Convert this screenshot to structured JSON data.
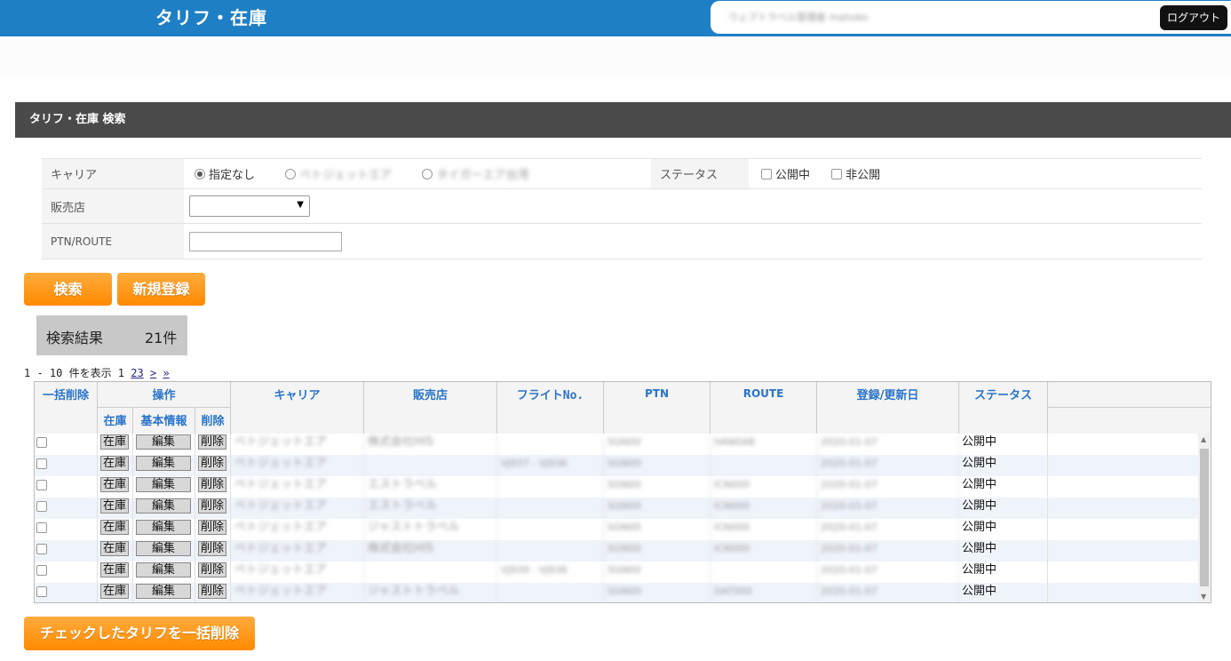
{
  "header": {
    "title": "タリフ・在庫",
    "user_name": "ウェブトラベル管理者 mahoko",
    "logout_label": "ログアウト"
  },
  "section": {
    "title": "タリフ・在庫 検索"
  },
  "form": {
    "carrier_label": "キャリア",
    "carrier_options": [
      "指定なし",
      "ベトジェットエア",
      "タイガーエア台湾"
    ],
    "carrier_selected": "指定なし",
    "status_label": "ステータス",
    "status_options": [
      "公開中",
      "非公開"
    ],
    "shop_label": "販売店",
    "shop_selected": "",
    "ptn_label": "PTN/ROUTE",
    "ptn_value": ""
  },
  "buttons": {
    "search": "検索",
    "new": "新規登録",
    "bulk_delete": "チェックしたタリフを一括削除"
  },
  "results": {
    "label": "検索結果",
    "count": "21件"
  },
  "pager": {
    "text": "1 - 10 件を表示 1",
    "page2": "2",
    "page3": "3",
    "next": ">",
    "last": "»"
  },
  "table": {
    "headers": {
      "bulk_delete": "一括削除",
      "operations": "操作",
      "stock": "在庫",
      "basic_info": "基本情報",
      "delete": "削除",
      "carrier": "キャリア",
      "shop": "販売店",
      "flight_no": "フライトNo.",
      "ptn": "PTN",
      "route": "ROUTE",
      "updated": "登録/更新日",
      "status": "ステータス"
    },
    "row_buttons": {
      "stock": "在庫",
      "edit": "編集",
      "delete": "削除"
    },
    "rows": [
      {
        "carrier": "ベトジェットエア",
        "shop": "株式会社HIS",
        "flight": "",
        "ptn": "SGN00",
        "route": "HAN0AB",
        "date": "2020-01-07",
        "status": "公開中"
      },
      {
        "carrier": "ベトジェットエア",
        "shop": "",
        "flight": "VJ937 - VJ936",
        "ptn": "SGN00",
        "route": "",
        "date": "2020-01-07",
        "status": "公開中"
      },
      {
        "carrier": "ベトジェットエア",
        "shop": "エストラベル",
        "flight": "",
        "ptn": "SGN00",
        "route": "ICN000",
        "date": "2020-01-07",
        "status": "公開中"
      },
      {
        "carrier": "ベトジェットエア",
        "shop": "エストラベル",
        "flight": "",
        "ptn": "SGN00",
        "route": "ICN000",
        "date": "2020-01-07",
        "status": "公開中"
      },
      {
        "carrier": "ベトジェットエア",
        "shop": "ジャストトラベル",
        "flight": "",
        "ptn": "SGN00",
        "route": "ICN000",
        "date": "2020-01-07",
        "status": "公開中"
      },
      {
        "carrier": "ベトジェットエア",
        "shop": "株式会社HIS",
        "flight": "",
        "ptn": "SGN00",
        "route": "ICN000",
        "date": "2020-01-07",
        "status": "公開中"
      },
      {
        "carrier": "ベトジェットエア",
        "shop": "",
        "flight": "VJ939 - VJ938",
        "ptn": "SGN00",
        "route": "",
        "date": "2020-01-07",
        "status": "公開中"
      },
      {
        "carrier": "ベトジェットエア",
        "shop": "ジャストトラベル",
        "flight": "",
        "ptn": "SGN00",
        "route": "DAT000",
        "date": "2020-01-07",
        "status": "公開中"
      }
    ]
  }
}
